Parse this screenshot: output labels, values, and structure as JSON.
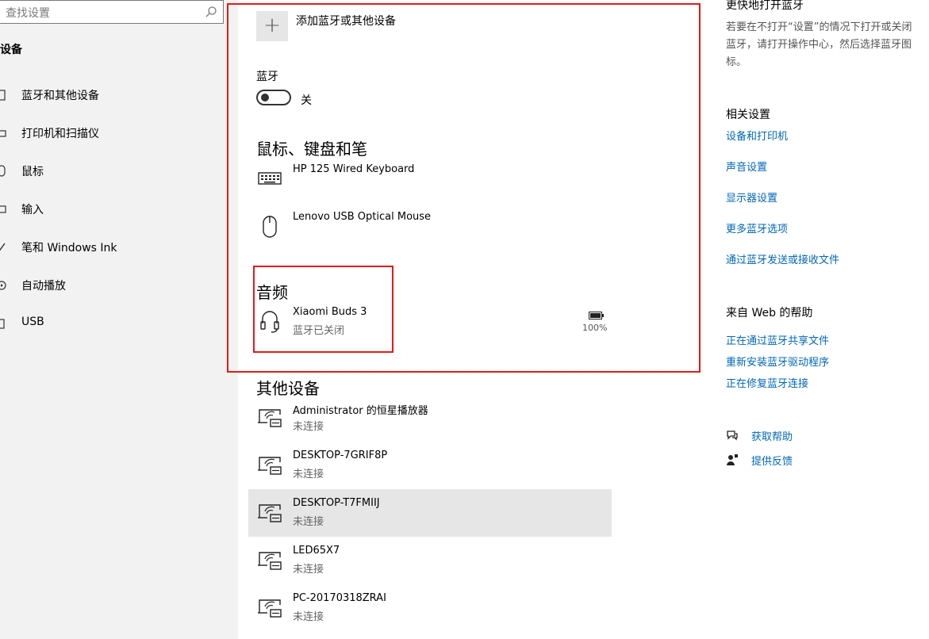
{
  "search": {
    "placeholder": "查找设置"
  },
  "sidebar": {
    "title": "设备",
    "items": [
      {
        "label": "蓝牙和其他设备",
        "icon": "bluetooth-devices-icon"
      },
      {
        "label": "打印机和扫描仪",
        "icon": "printer-icon"
      },
      {
        "label": "鼠标",
        "icon": "mouse-icon"
      },
      {
        "label": "输入",
        "icon": "keyboard-icon"
      },
      {
        "label": "笔和 Windows Ink",
        "icon": "pen-icon"
      },
      {
        "label": "自动播放",
        "icon": "autoplay-icon"
      },
      {
        "label": "USB",
        "icon": "usb-icon"
      }
    ]
  },
  "main": {
    "add_label": "添加蓝牙或其他设备",
    "add_symbol": "+",
    "bluetooth": {
      "label": "蓝牙",
      "state": "关"
    },
    "mouse_section": {
      "heading": "鼠标、键盘和笔",
      "devices": [
        {
          "name": "HP 125 Wired Keyboard",
          "icon": "keyboard-icon"
        },
        {
          "name": "Lenovo USB Optical Mouse",
          "icon": "mouse-icon"
        }
      ]
    },
    "audio_section": {
      "heading": "音频",
      "devices": [
        {
          "name": "Xiaomi Buds 3",
          "status": "蓝牙已关闭",
          "battery": "100%",
          "icon": "headset-icon"
        }
      ]
    },
    "other_section": {
      "heading": "其他设备",
      "devices": [
        {
          "name": "Administrator 的恒星播放器",
          "status": "未连接",
          "icon": "media-device-icon"
        },
        {
          "name": "DESKTOP-7GRIF8P",
          "status": "未连接",
          "icon": "media-device-icon"
        },
        {
          "name": "DESKTOP-T7FMIIJ",
          "status": "未连接",
          "icon": "media-device-icon"
        },
        {
          "name": "LED65X7",
          "status": "未连接",
          "icon": "media-device-icon"
        },
        {
          "name": "PC-20170318ZRAI",
          "status": "未连接",
          "icon": "media-device-icon"
        }
      ]
    }
  },
  "right": {
    "quick_heading": "更快地打开蓝牙",
    "quick_desc": "若要在不打开“设置”的情况下打开或关闭蓝牙，请打开操作中心，然后选择蓝牙图标。",
    "related_heading": "相关设置",
    "related_links": [
      "设备和打印机",
      "声音设置",
      "显示器设置",
      "更多蓝牙选项",
      "通过蓝牙发送或接收文件"
    ],
    "web_heading": "来自 Web 的帮助",
    "web_links": [
      "正在通过蓝牙共享文件",
      "重新安装蓝牙驱动程序",
      "正在修复蓝牙连接"
    ],
    "help": [
      {
        "label": "获取帮助",
        "icon": "help-chat-icon"
      },
      {
        "label": "提供反馈",
        "icon": "feedback-icon"
      }
    ]
  },
  "colors": {
    "link": "#0067b8",
    "highlight_box": "#e21b1b",
    "sidebar_bg": "#f2f2f2",
    "selected_row": "#e6e6e6"
  }
}
